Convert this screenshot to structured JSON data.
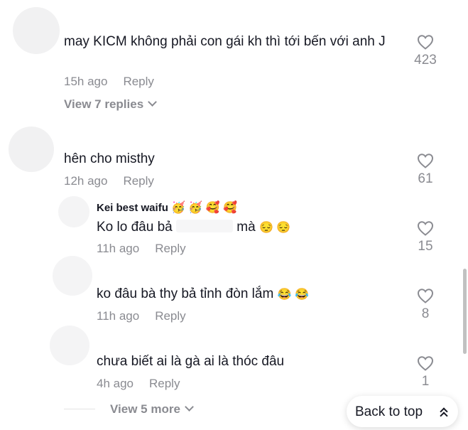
{
  "comments": [
    {
      "text": "may KICM không phải con gái kh thì tới bến với anh J",
      "time": "15h ago",
      "reply_label": "Reply",
      "likes": "423",
      "view_replies": "View 7 replies"
    },
    {
      "text": "hên cho misthy",
      "time": "12h ago",
      "reply_label": "Reply",
      "likes": "61",
      "replies": [
        {
          "username": "Kei best waifu",
          "username_emojis": "🥳 🥳 🥰 🥰",
          "text_prefix": "Ko lo đâu bả",
          "text_suffix": "mà",
          "text_emojis": "😔 😔",
          "time": "11h ago",
          "reply_label": "Reply",
          "likes": "15"
        },
        {
          "text": "ko đâu bà thy bả tỉnh đòn lắm",
          "text_emojis": "😂 😂",
          "time": "11h ago",
          "reply_label": "Reply",
          "likes": "8"
        },
        {
          "text": "chưa biết ai là gà ai là thóc đâu",
          "time": "4h ago",
          "reply_label": "Reply",
          "likes": "1"
        }
      ],
      "view_more": "View 5 more"
    }
  ],
  "back_to_top": "Back to top",
  "colors": {
    "text": "#161823",
    "muted": "#8a8b91",
    "background": "#ffffff"
  },
  "icons": {
    "like": "heart-outline-icon",
    "expand": "chevron-down-icon",
    "back_to_top": "double-chevron-up-icon"
  }
}
